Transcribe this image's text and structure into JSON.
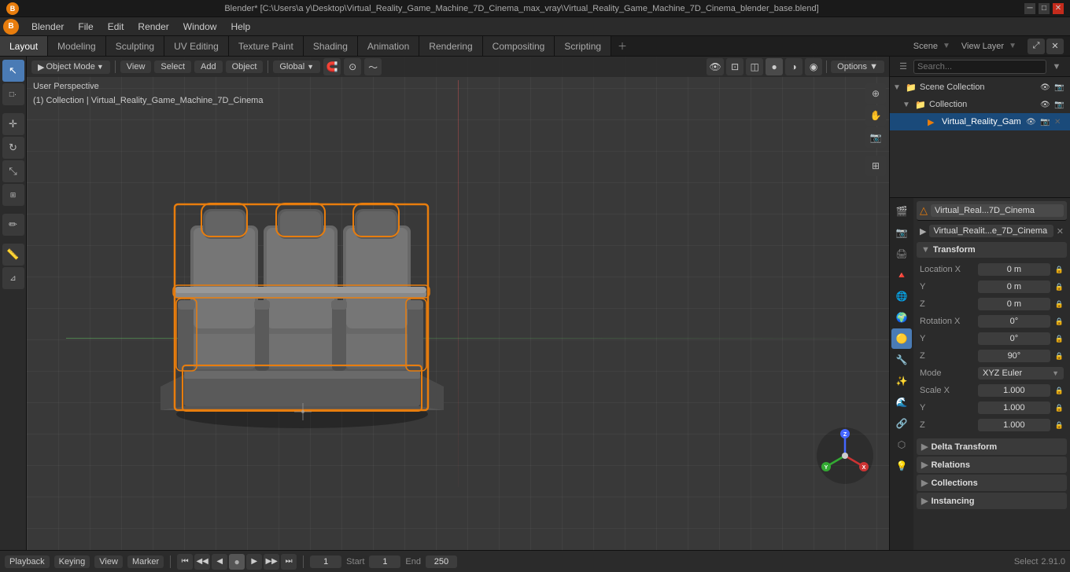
{
  "window": {
    "title": "Blender* [C:\\Users\\a y\\Desktop\\Virtual_Reality_Game_Machine_7D_Cinema_max_vray\\Virtual_Reality_Game_Machine_7D_Cinema_blender_base.blend]",
    "controls": [
      "─",
      "□",
      "✕"
    ]
  },
  "menubar": {
    "logo": "B",
    "items": [
      "Blender",
      "File",
      "Edit",
      "Render",
      "Window",
      "Help"
    ]
  },
  "workspace_tabs": {
    "tabs": [
      "Layout",
      "Modeling",
      "Sculpting",
      "UV Editing",
      "Texture Paint",
      "Shading",
      "Animation",
      "Rendering",
      "Compositing",
      "Scripting"
    ],
    "active": "Layout",
    "right_label": "View Layer",
    "scene_label": "Scene"
  },
  "viewport": {
    "mode": "Object Mode",
    "view_menu": "View",
    "select_menu": "Select",
    "add_menu": "Add",
    "object_menu": "Object",
    "transform": "Global",
    "snap_icon": "🧲",
    "proportional": "⊙",
    "info_line1": "User Perspective",
    "info_line2": "(1) Collection | Virtual_Reality_Game_Machine_7D_Cinema",
    "frame_current": "1",
    "frame_start": "1",
    "frame_end": "250",
    "start_label": "Start",
    "end_label": "End"
  },
  "outliner": {
    "search_placeholder": "Search...",
    "items": [
      {
        "name": "Scene Collection",
        "level": 0,
        "icon": "📁",
        "expanded": true,
        "selected": false
      },
      {
        "name": "Collection",
        "level": 1,
        "icon": "📁",
        "expanded": true,
        "selected": false
      },
      {
        "name": "Virtual_Reality_Gam",
        "level": 2,
        "icon": "▶",
        "expanded": false,
        "selected": true
      }
    ]
  },
  "properties": {
    "object_icon": "△",
    "object_name": "Virtual_Real...7D_Cinema",
    "data_name": "Virtual_Realit...e_7D_Cinema",
    "sections": {
      "transform": {
        "label": "Transform",
        "location": {
          "x": "0 m",
          "y": "0 m",
          "z": "0 m"
        },
        "rotation": {
          "x": "0°",
          "y": "0°",
          "z": "90°"
        },
        "mode": "XYZ Euler",
        "scale": {
          "x": "1.000",
          "y": "1.000",
          "z": "1.000"
        }
      },
      "delta_transform": {
        "label": "Delta Transform",
        "collapsed": true
      },
      "relations": {
        "label": "Relations",
        "collapsed": true
      },
      "collections": {
        "label": "Collections",
        "collapsed": true
      },
      "instancing": {
        "label": "Instancing",
        "collapsed": true
      }
    },
    "tabs": [
      "🔧",
      "📷",
      "🔺",
      "🟡",
      "🔗",
      "🌊",
      "⬡",
      "💡",
      "🌐",
      "🎬",
      "🔒"
    ],
    "active_tab": 3
  },
  "timeline": {
    "playback_label": "Playback",
    "keying_label": "Keying",
    "view_label": "View",
    "marker_label": "Marker",
    "transport": [
      "⏮",
      "◀◀",
      "◀",
      "⏹",
      "▶",
      "▶▶",
      "⏭"
    ],
    "frame_dot": "●",
    "status_left": "Select",
    "status_right": "2.91.0",
    "version": "2.91.0"
  },
  "statusbar": {
    "left": "Select",
    "right": "2.91.0"
  },
  "colors": {
    "accent_orange": "#e87d0d",
    "accent_blue": "#4a7bb5",
    "selection_orange": "#e87d0d",
    "bg_main": "#393939",
    "bg_panel": "#2b2b2b",
    "bg_dark": "#1e1e1e",
    "bg_header": "#252525",
    "text_main": "#cccccc",
    "grid_line": "rgba(255,255,255,0.04)"
  }
}
